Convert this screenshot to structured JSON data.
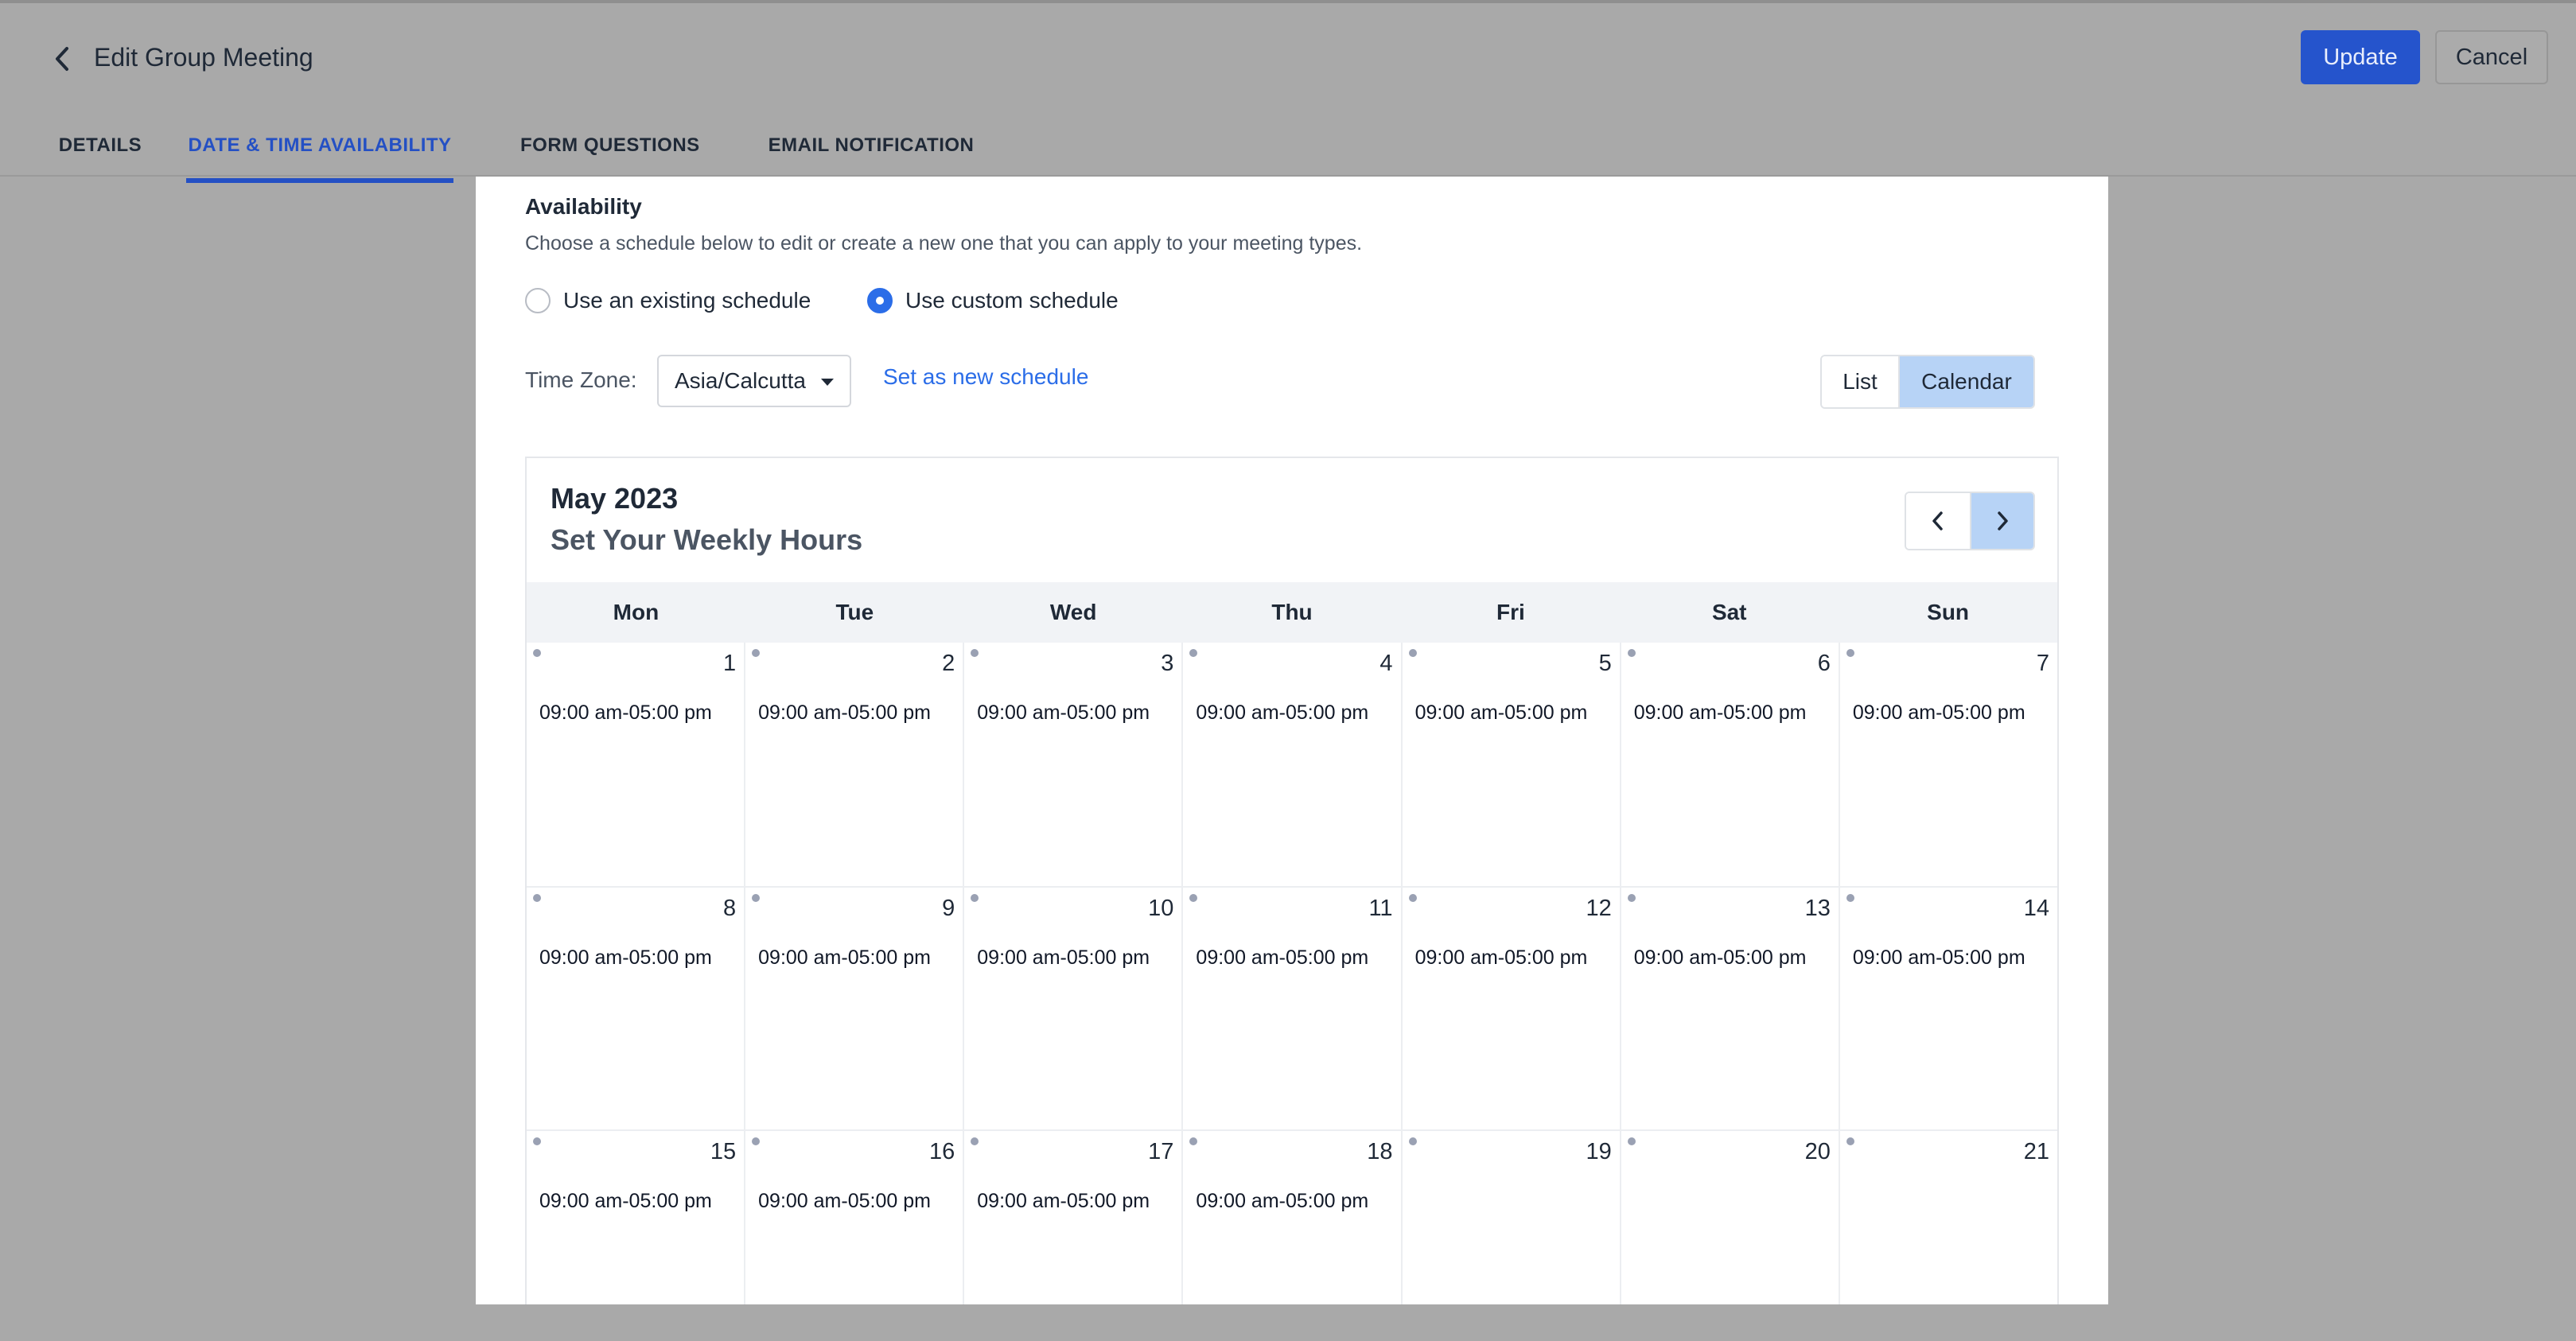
{
  "header": {
    "title": "Edit Group Meeting",
    "update_label": "Update",
    "cancel_label": "Cancel"
  },
  "tabs": [
    {
      "label": "DETAILS"
    },
    {
      "label": "DATE & TIME AVAILABILITY",
      "active": true
    },
    {
      "label": "FORM QUESTIONS"
    },
    {
      "label": "EMAIL NOTIFICATION"
    }
  ],
  "availability": {
    "title": "Availability",
    "description": "Choose a schedule below to edit or create a new one that you can apply to your meeting types.",
    "option_existing": "Use an existing schedule",
    "option_custom": "Use custom schedule",
    "selected_option": "custom",
    "timezone_label": "Time Zone:",
    "timezone_value": "Asia/Calcutta",
    "set_new_label": "Set as new schedule",
    "view_list": "List",
    "view_calendar": "Calendar",
    "active_view": "Calendar"
  },
  "calendar": {
    "month": "May 2023",
    "subtitle": "Set Your Weekly Hours",
    "weekdays": [
      "Mon",
      "Tue",
      "Wed",
      "Thu",
      "Fri",
      "Sat",
      "Sun"
    ],
    "weeks": [
      [
        {
          "day": "1",
          "hours": "09:00 am-05:00 pm"
        },
        {
          "day": "2",
          "hours": "09:00 am-05:00 pm"
        },
        {
          "day": "3",
          "hours": "09:00 am-05:00 pm"
        },
        {
          "day": "4",
          "hours": "09:00 am-05:00 pm"
        },
        {
          "day": "5",
          "hours": "09:00 am-05:00 pm"
        },
        {
          "day": "6",
          "hours": "09:00 am-05:00 pm"
        },
        {
          "day": "7",
          "hours": "09:00 am-05:00 pm"
        }
      ],
      [
        {
          "day": "8",
          "hours": "09:00 am-05:00 pm"
        },
        {
          "day": "9",
          "hours": "09:00 am-05:00 pm"
        },
        {
          "day": "10",
          "hours": "09:00 am-05:00 pm"
        },
        {
          "day": "11",
          "hours": "09:00 am-05:00 pm"
        },
        {
          "day": "12",
          "hours": "09:00 am-05:00 pm"
        },
        {
          "day": "13",
          "hours": "09:00 am-05:00 pm"
        },
        {
          "day": "14",
          "hours": "09:00 am-05:00 pm"
        }
      ],
      [
        {
          "day": "15",
          "hours": "09:00 am-05:00 pm"
        },
        {
          "day": "16",
          "hours": "09:00 am-05:00 pm"
        },
        {
          "day": "17",
          "hours": "09:00 am-05:00 pm"
        },
        {
          "day": "18",
          "hours": "09:00 am-05:00 pm"
        },
        {
          "day": "19",
          "hours": ""
        },
        {
          "day": "20",
          "hours": ""
        },
        {
          "day": "21",
          "hours": ""
        }
      ]
    ]
  },
  "colors": {
    "accent": "#2554cc",
    "link": "#2b6de8",
    "toggle_active": "#b7d3f6",
    "overlay": "#a9a9a9"
  },
  "icons": {
    "back": "chevron-left-icon",
    "prev": "chevron-left-icon",
    "next": "chevron-right-icon",
    "dropdown": "caret-down-icon"
  }
}
